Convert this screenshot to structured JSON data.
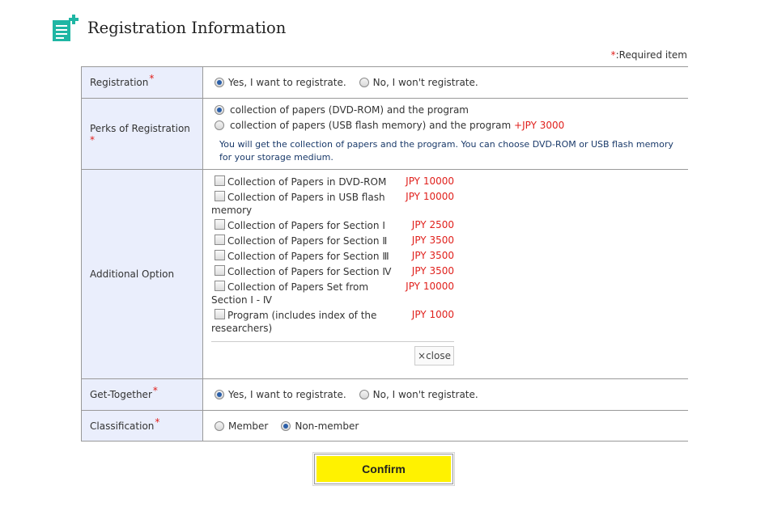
{
  "header": {
    "title": "Registration Information",
    "icon": "document-add-icon",
    "icon_color": "#1fb6a4"
  },
  "required_note": {
    "asterisk": "*",
    "text": ":Required item"
  },
  "rows": {
    "registration": {
      "label": "Registration",
      "required": "*",
      "options": [
        "Yes, I want to registrate.",
        "No, I won't registrate."
      ],
      "selected": 0
    },
    "perks": {
      "label": "Perks of Registration",
      "required": "*",
      "option_1": "collection of papers (DVD-ROM) and the program",
      "option_2": "collection of papers (USB flash memory) and the program",
      "option_2_price": "+JPY 3000",
      "selected": 0,
      "note": "You will get the collection of papers and the program. You can choose DVD-ROM or USB flash memory for your storage medium."
    },
    "additional": {
      "label": "Additional Option",
      "items": [
        {
          "name": "Collection of Papers in DVD-ROM",
          "price": "JPY 10000"
        },
        {
          "name": "Collection of Papers in USB flash memory",
          "price": "JPY 10000"
        },
        {
          "name": "Collection of Papers for Section Ⅰ",
          "price": "JPY 2500"
        },
        {
          "name": "Collection of Papers for Section Ⅱ",
          "price": "JPY 3500"
        },
        {
          "name": "Collection of Papers for Section Ⅲ",
          "price": "JPY 3500"
        },
        {
          "name": "Collection of Papers for Section Ⅳ",
          "price": "JPY 3500"
        },
        {
          "name": "Collection of Papers Set from Section Ⅰ - Ⅳ",
          "price": "JPY 10000"
        },
        {
          "name": "Program (includes index of the researchers)",
          "price": "JPY 1000"
        }
      ],
      "close_label": "×close"
    },
    "get_together": {
      "label": "Get-Together",
      "required": "*",
      "options": [
        "Yes, I want to registrate.",
        "No, I won't registrate."
      ],
      "selected": 0
    },
    "classification": {
      "label": "Classification",
      "required": "*",
      "options": [
        "Member",
        "Non-member"
      ],
      "selected": 1
    }
  },
  "confirm_label": "Confirm",
  "colors": {
    "label_bg": "#eaeefc",
    "required": "#e0201c",
    "price": "#e0201c",
    "confirm_bg": "#fff200",
    "note_text": "#1a3a6a"
  }
}
